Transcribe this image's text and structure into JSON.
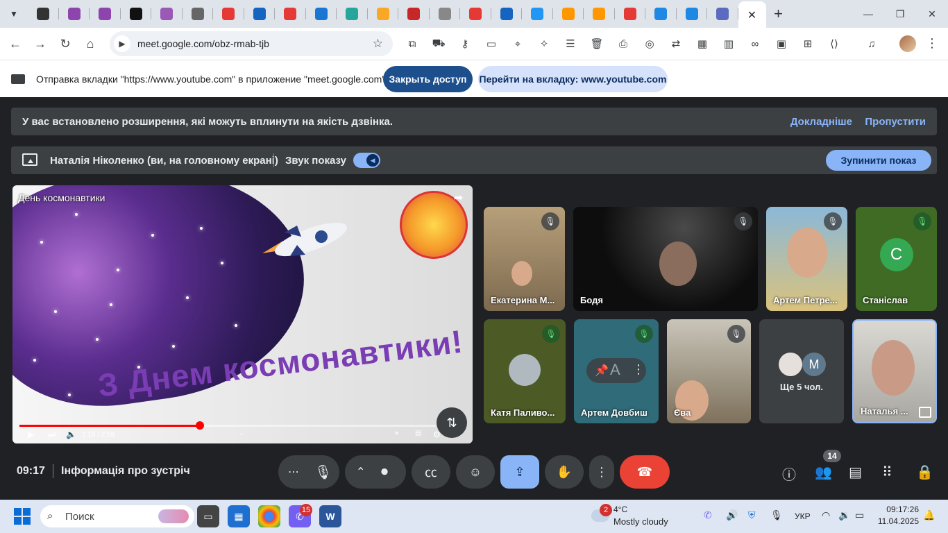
{
  "browser": {
    "url": "meet.google.com/obz-rmab-tjb",
    "tab_favicons": [
      "tab-1",
      "tab-2",
      "tab-3",
      "tab-4",
      "tab-5",
      "tab-6",
      "tab-7",
      "tab-8",
      "tab-9",
      "tab-10",
      "tab-11",
      "tab-12",
      "tab-13",
      "tab-14",
      "tab-15",
      "tab-16",
      "tab-17",
      "tab-18",
      "tab-19",
      "tab-20",
      "tab-21",
      "tab-22",
      "tab-23"
    ]
  },
  "share_infobar": {
    "text": "Отправка вкладки \"https://www.youtube.com\" в приложение \"meet.google.com\"...",
    "stop_label": "Закрыть доступ",
    "switch_label": "Перейти на вкладку: www.youtube.com"
  },
  "extensions_warning": {
    "text": "У вас встановлено розширення, які можуть вплинути на якість дзвінка.",
    "more_label": "Докладніше",
    "skip_label": "Пропустити"
  },
  "presenting_bar": {
    "presenter": "Наталія Ніколенко (ви, на головному екрані)",
    "sound_label": "Звук показу",
    "sound_on": true,
    "stop_label": "Зупинити показ"
  },
  "video": {
    "title": "День космонавтики",
    "headline": "З Днем космонавтики!",
    "time": "1:18 / 2:59",
    "progress_fraction": 0.433
  },
  "participants": [
    {
      "name": "Екатерина М...",
      "muted": true,
      "mic_green": false
    },
    {
      "name": "Бодя",
      "muted": true,
      "mic_green": false
    },
    {
      "name": "Артем Петре...",
      "muted": true,
      "mic_green": false
    },
    {
      "name": "Станіслав",
      "initial": "С",
      "muted": true,
      "mic_green": true
    },
    {
      "name": "Катя Паливо...",
      "muted": true,
      "mic_green": true
    },
    {
      "name": "Артем Довбиш",
      "initial": "А",
      "muted": true,
      "mic_green": true
    },
    {
      "name": "Єва",
      "muted": true,
      "mic_green": false
    },
    {
      "name": "Ще 5 чол.",
      "initial": "M"
    },
    {
      "name": "Наталья ..."
    }
  ],
  "bottom_bar": {
    "clock": "09:17",
    "meeting_info": "Інформація про зустріч",
    "people_count": "14"
  },
  "taskbar": {
    "search_placeholder": "Поиск",
    "viber_badge": "15",
    "weather_badge": "2",
    "temperature": "4°C",
    "weather": "Mostly cloudy",
    "lang": "УКР",
    "time": "09:17:26",
    "date": "11.04.2025"
  },
  "colors": {
    "meet_bg": "#202124",
    "panel": "#3c4043",
    "accent": "#8ab4f8",
    "end_call": "#ea4335",
    "share_stop": "#1d4f8c"
  }
}
